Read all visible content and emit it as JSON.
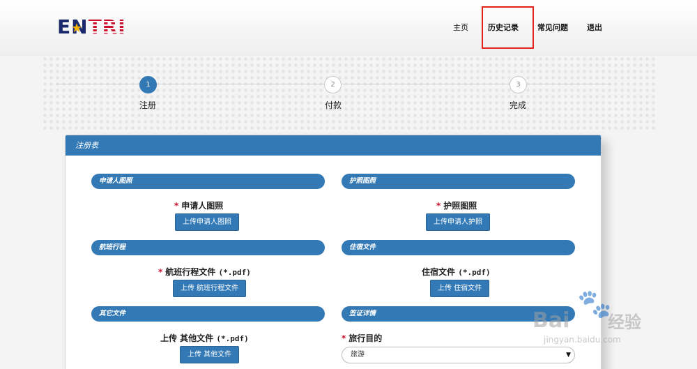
{
  "logo": {
    "part1": "EN",
    "part2": "TRI"
  },
  "nav": {
    "home": "主页",
    "history": "历史记录",
    "faq": "常见问题",
    "logout": "退出"
  },
  "steps": [
    {
      "number": "1",
      "label": "注册",
      "active": true
    },
    {
      "number": "2",
      "label": "付款",
      "active": false
    },
    {
      "number": "3",
      "label": "完成",
      "active": false
    }
  ],
  "panel": {
    "title": "注册表"
  },
  "sections": {
    "applicant_photo": {
      "header": "申请人图照",
      "required": "*",
      "label": "申请人图照",
      "button": "上传申请人图照"
    },
    "passport_photo": {
      "header": "护照图照",
      "required": "*",
      "label": "护照图照",
      "button": "上传申请人护照"
    },
    "flight_itinerary": {
      "header": "航班行程",
      "required": "*",
      "label": "航班行程文件",
      "suffix": "(*.pdf)",
      "button": "上传 航班行程文件"
    },
    "accommodation": {
      "header": "住宿文件",
      "label": "住宿文件",
      "suffix": "(*.pdf)",
      "button": "上传 住宿文件"
    },
    "other_documents": {
      "header": "其它文件",
      "label": "上传 其他文件",
      "suffix": "(*.pdf)",
      "button": "上传 其他文件"
    },
    "visa_details": {
      "header": "签证详情",
      "required": "*",
      "label": "旅行目的",
      "select_value": "旅游"
    }
  },
  "watermark": {
    "brand": "Bai",
    "brand2": "经验",
    "url": "jingyan.baidu.com"
  },
  "icons": {
    "select_caret": "caret-down-icon",
    "watermark_paw": "paw-icon"
  },
  "colors": {
    "primary": "#3379b5",
    "required": "#c8102e",
    "highlight": "#e2231a"
  }
}
